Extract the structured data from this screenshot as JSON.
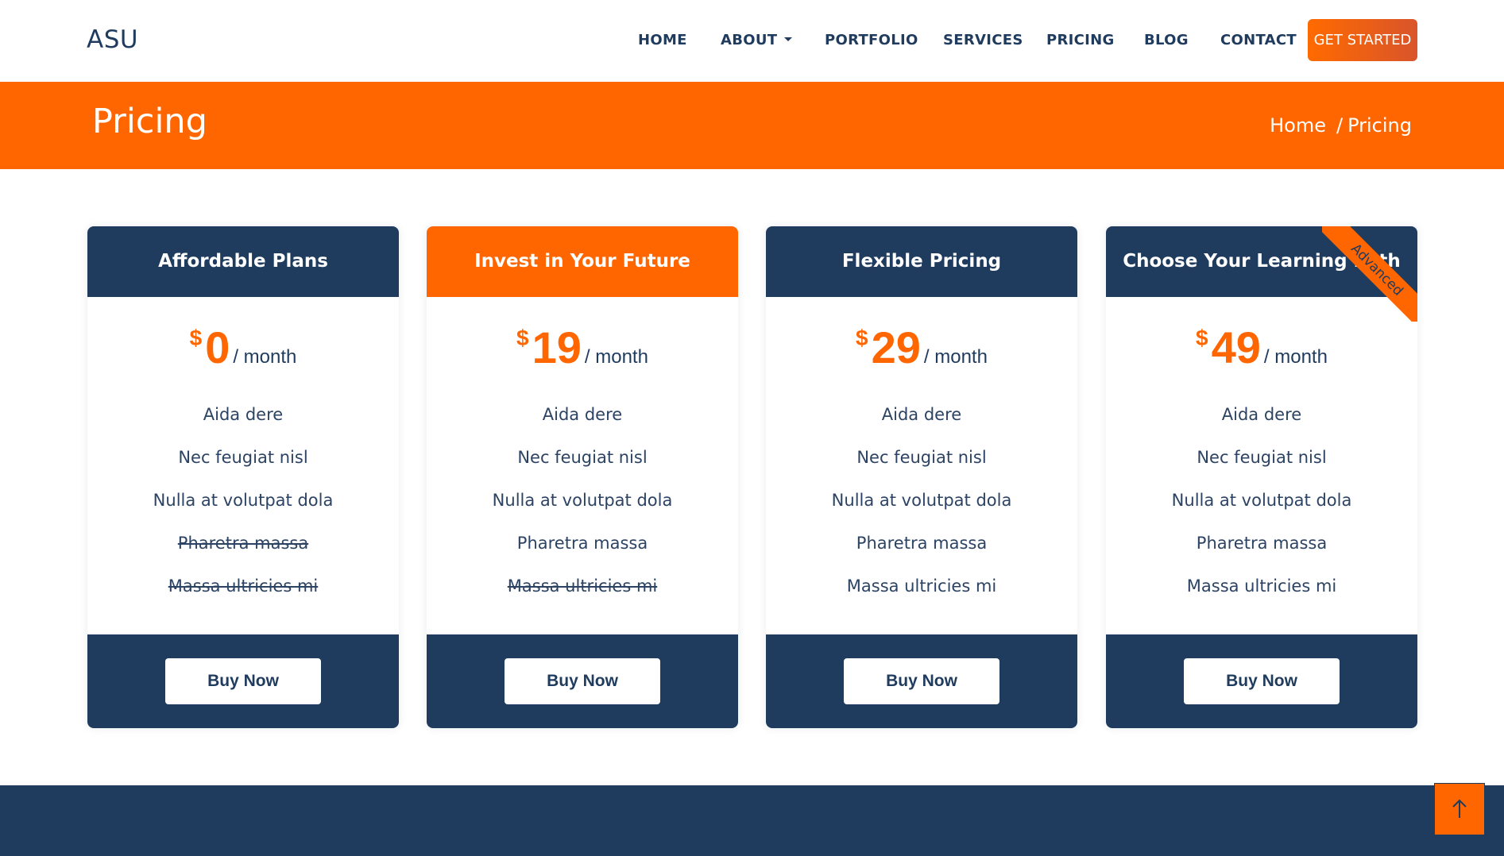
{
  "header": {
    "logo": "ASU",
    "nav": [
      {
        "label": "HOME"
      },
      {
        "label": "ABOUT"
      },
      {
        "label": "PORTFOLIO"
      },
      {
        "label": "SERVICES"
      },
      {
        "label": "PRICING"
      },
      {
        "label": "BLOG"
      },
      {
        "label": "CONTACT"
      }
    ],
    "cta_label": "GET STARTED"
  },
  "banner": {
    "title": "Pricing",
    "breadcrumb": [
      "Home",
      "/",
      "Pricing"
    ]
  },
  "plans": [
    {
      "title": "Affordable Plans",
      "currency": "$",
      "amount": "0",
      "period": "/ month",
      "features": [
        {
          "label": "Aida dere",
          "available": true
        },
        {
          "label": "Nec feugiat nisl",
          "available": true
        },
        {
          "label": "Nulla at volutpat dola",
          "available": true
        },
        {
          "label": "Pharetra massa",
          "available": false
        },
        {
          "label": "Massa ultricies mi",
          "available": false
        }
      ],
      "button": "Buy Now"
    },
    {
      "title": "Invest in Your Future",
      "currency": "$",
      "amount": "19",
      "period": "/ month",
      "featured": true,
      "features": [
        {
          "label": "Aida dere",
          "available": true
        },
        {
          "label": "Nec feugiat nisl",
          "available": true
        },
        {
          "label": "Nulla at volutpat dola",
          "available": true
        },
        {
          "label": "Pharetra massa",
          "available": true
        },
        {
          "label": "Massa ultricies mi",
          "available": false
        }
      ],
      "button": "Buy Now"
    },
    {
      "title": "Flexible Pricing",
      "currency": "$",
      "amount": "29",
      "period": "/ month",
      "features": [
        {
          "label": "Aida dere",
          "available": true
        },
        {
          "label": "Nec feugiat nisl",
          "available": true
        },
        {
          "label": "Nulla at volutpat dola",
          "available": true
        },
        {
          "label": "Pharetra massa",
          "available": true
        },
        {
          "label": "Massa ultricies mi",
          "available": true
        }
      ],
      "button": "Buy Now"
    },
    {
      "title": "Choose Your Learning Path",
      "currency": "$",
      "amount": "49",
      "period": "/ month",
      "ribbon": "Advanced",
      "features": [
        {
          "label": "Aida dere",
          "available": true
        },
        {
          "label": "Nec feugiat nisl",
          "available": true
        },
        {
          "label": "Nulla at volutpat dola",
          "available": true
        },
        {
          "label": "Pharetra massa",
          "available": true
        },
        {
          "label": "Massa ultricies mi",
          "available": true
        }
      ],
      "button": "Buy Now"
    }
  ],
  "back_to_top_icon": "arrow-up-icon",
  "colors": {
    "accent": "#ff6600",
    "navy": "#1f3b5e",
    "white": "#ffffff"
  }
}
